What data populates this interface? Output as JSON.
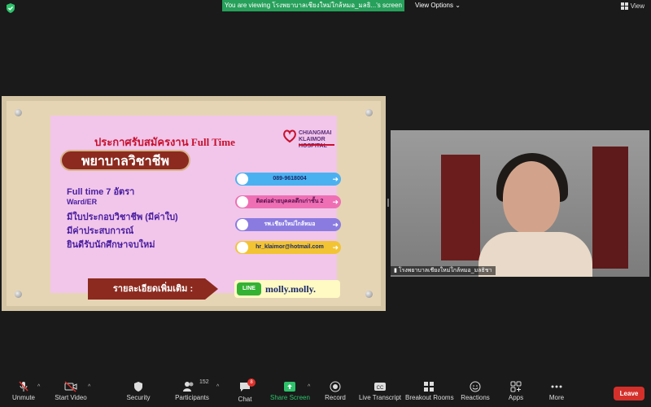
{
  "banner": {
    "text": "You are viewing โรงพยาบาลเชียงใหม่ใกล้หมอ_มลธิ...'s screen"
  },
  "view_options": {
    "label": "View Options ⌄"
  },
  "view_button": {
    "label": "View"
  },
  "poster": {
    "title": "ประกาศรับสมัครงาน Full Time",
    "logo_name": "CHIANGMAI KLAIMOR HOSPITAL",
    "position": "พยาบาลวิชาชีพ",
    "bullets": [
      "Full time 7 อัตรา",
      "Ward/ER",
      "มีใบประกอบวิชาชีพ (มีค่าใบ)",
      "มีค่าประสบการณ์",
      "ยินดีรับนักศึกษาจบใหม่"
    ],
    "contacts": [
      "089-9618004",
      "ติดต่อฝ่ายบุคคลตึกเก่าชั้น 2",
      "รพ.เชียงใหม่ใกล้หมอ",
      "hr_klaimor@hotmail.com"
    ],
    "more_info": "รายละเอียดเพิ่มเติม :",
    "line_label": "LINE",
    "line_id": "molly.molly."
  },
  "participant": {
    "name": "โรงพยาบาลเชียงใหม่ใกล้หมอ_มลธิชา"
  },
  "toolbar": {
    "unmute": "Unmute",
    "start_video": "Start Video",
    "security": "Security",
    "participants": "Participants",
    "participants_count": "152",
    "chat": "Chat",
    "chat_badge": "8",
    "share_screen": "Share Screen",
    "record": "Record",
    "live_transcript": "Live Transcript",
    "breakout_rooms": "Breakout Rooms",
    "reactions": "Reactions",
    "apps": "Apps",
    "more": "More",
    "leave": "Leave"
  },
  "colors": {
    "share_green": "#2ec26b",
    "leave_red": "#d4302b",
    "poster_pink": "#f1c6ea",
    "title_red": "#c8102e",
    "text_purple": "#4a1da0"
  }
}
